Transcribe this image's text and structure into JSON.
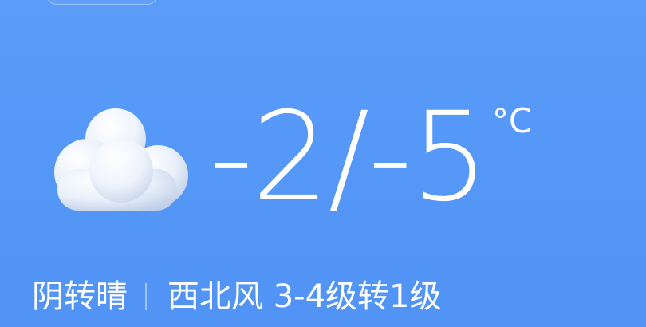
{
  "weather": {
    "icon": "cloudy-icon",
    "temperature": "-2/-5",
    "unit": "°C",
    "condition": "阴转晴",
    "wind": "西北风 3-4级转1级"
  },
  "colors": {
    "background": "#5597f7",
    "text": "#ffffff"
  }
}
